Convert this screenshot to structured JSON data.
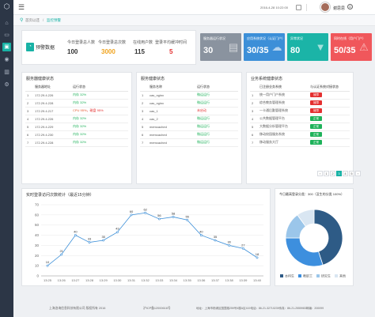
{
  "topbar": {
    "date_text": "2016-4-28  10:22:00",
    "user_name": "谢思思"
  },
  "breadcrumb": {
    "home": "首页以还",
    "current": "监控预警"
  },
  "stats_header": {
    "title": "预警数据"
  },
  "stats": [
    {
      "label": "今日登录总人数",
      "value": "100",
      "color": "#333333"
    },
    {
      "label": "今日登录总次数",
      "value": "3000",
      "color": "#f0a31e"
    },
    {
      "label": "在线用户数",
      "value": "115",
      "color": "#333333"
    },
    {
      "label": "登录平均缓冲时间",
      "value": "5",
      "color": "#e43030"
    }
  ],
  "cards": [
    {
      "label": "服务器运行状况",
      "value": "30",
      "color": "#8a939f",
      "icon": "server-icon"
    },
    {
      "label": "应用系统状况（认证门户）",
      "value": "30/35",
      "color": "#3c8fd8",
      "icon": "cloud-icon"
    },
    {
      "label": "异常状况",
      "value": "80",
      "color": "#1bb4a7",
      "icon": "shield-icon"
    },
    {
      "label": "同时在线（用户门户）",
      "value": "50/35",
      "color": "#f0575b",
      "icon": "warning-icon"
    }
  ],
  "server_panel": {
    "title": "服务器健康状态",
    "headers": [
      "服务器地址",
      "运行状态"
    ],
    "rows": [
      {
        "num": "1",
        "ip": "172.29.4.226",
        "status": "内存 32%",
        "status2": "",
        "kind": "ok"
      },
      {
        "num": "2",
        "ip": "172.29.4.228",
        "status": "内存 32%",
        "status2": "",
        "kind": "ok"
      },
      {
        "num": "3",
        "ip": "172.29.4.217",
        "status": "CPU 95%",
        "status2": "，磁盘 95%",
        "kind": "warn"
      },
      {
        "num": "4",
        "ip": "172.29.4.226",
        "status": "内存 32%",
        "status2": "",
        "kind": "ok"
      },
      {
        "num": "5",
        "ip": "172.29.4.229",
        "status": "内存 32%",
        "status2": "",
        "kind": "ok"
      },
      {
        "num": "6",
        "ip": "172.29.4.230",
        "status": "内存 32%",
        "status2": "",
        "kind": "ok"
      },
      {
        "num": "7",
        "ip": "172.29.4.228",
        "status": "内存 32%",
        "status2": "",
        "kind": "ok"
      }
    ]
  },
  "service_panel": {
    "title": "服务健康状态",
    "headers": [
      "服务名称",
      "运行状态"
    ],
    "rows": [
      {
        "num": "1",
        "name": "cas_nginx",
        "status": "微运运行",
        "kind": "ok"
      },
      {
        "num": "2",
        "name": "cas_nginx",
        "status": "微运运行",
        "kind": "ok"
      },
      {
        "num": "3",
        "name": "cas_1",
        "status": "未启动",
        "kind": "red"
      },
      {
        "num": "4",
        "name": "cas_2",
        "status": "微运运行",
        "kind": "ok"
      },
      {
        "num": "5",
        "name": "memcached",
        "status": "微运运行",
        "kind": "ok"
      },
      {
        "num": "6",
        "name": "memcached",
        "status": "微运运行",
        "kind": "ok"
      },
      {
        "num": "7",
        "name": "memcached",
        "status": "微运运行",
        "kind": "ok"
      }
    ]
  },
  "biz_panel": {
    "title": "业务系统健康状态",
    "headers": [
      "已注册业务系统",
      "与认证系统对接状态"
    ],
    "rows": [
      {
        "num": "1",
        "name": "统一用户门户系统",
        "status": "故障",
        "kind": "red"
      },
      {
        "num": "2",
        "name": "综合教务管理系统",
        "status": "故障",
        "kind": "red"
      },
      {
        "num": "3",
        "name": "一卡通后勤管理系统",
        "status": "故障",
        "kind": "red"
      },
      {
        "num": "4",
        "name": "公共数据管理平台",
        "status": "正常",
        "kind": "ok"
      },
      {
        "num": "5",
        "name": "大数据分析管理平台",
        "status": "正常",
        "kind": "ok"
      },
      {
        "num": "6",
        "name": "移动校园服务系统",
        "status": "正常",
        "kind": "ok"
      },
      {
        "num": "7",
        "name": "移动服务大厅",
        "status": "正常",
        "kind": "ok"
      }
    ],
    "pages": [
      "‹",
      "1",
      "2",
      "3",
      "4",
      "5",
      "›"
    ],
    "active_page": "3"
  },
  "line_panel": {
    "title": "实时登录访问次数统计（最近15分钟）"
  },
  "pie_panel": {
    "title": "今日最高登录分类：300（没生的分类 100%）"
  },
  "chart_data": [
    {
      "type": "line",
      "title": "实时登录访问次数统计（最近15分钟）",
      "categories": [
        "13:25",
        "13:26",
        "13:27",
        "13:28",
        "13:29",
        "13:30",
        "13:31",
        "13:32",
        "13:33",
        "13:34",
        "13:35",
        "13:36",
        "13:37",
        "13:38",
        "13:39",
        "13:40"
      ],
      "values": [
        10,
        21,
        40,
        33,
        35,
        43,
        60,
        62,
        56,
        58,
        55,
        40,
        35,
        30,
        27,
        18
      ],
      "ylim": [
        0,
        70
      ],
      "yticks": [
        0,
        10,
        20,
        30,
        40,
        50,
        60,
        70
      ],
      "grid": true,
      "line_color": "#3c8fd8"
    },
    {
      "type": "pie",
      "title": "今日最高登录分类：300（没生的分类 100%）",
      "categories": [
        "本科生",
        "教职工",
        "研究生",
        "其他"
      ],
      "values": [
        45,
        30,
        15,
        10
      ],
      "colors": [
        "#2e5b86",
        "#3d8fde",
        "#9bc6ea",
        "#d9e6f2"
      ],
      "donut": true
    }
  ],
  "footer": {
    "left": "上海咨询信息科技有限公司  版权所有 2016",
    "icp": "沪ICP备12000616号",
    "right": "地址：上海市杨浦区国霞路259号4楼A区419电话：86-21-32710239传真：86-21-2555983邮编：200099"
  }
}
